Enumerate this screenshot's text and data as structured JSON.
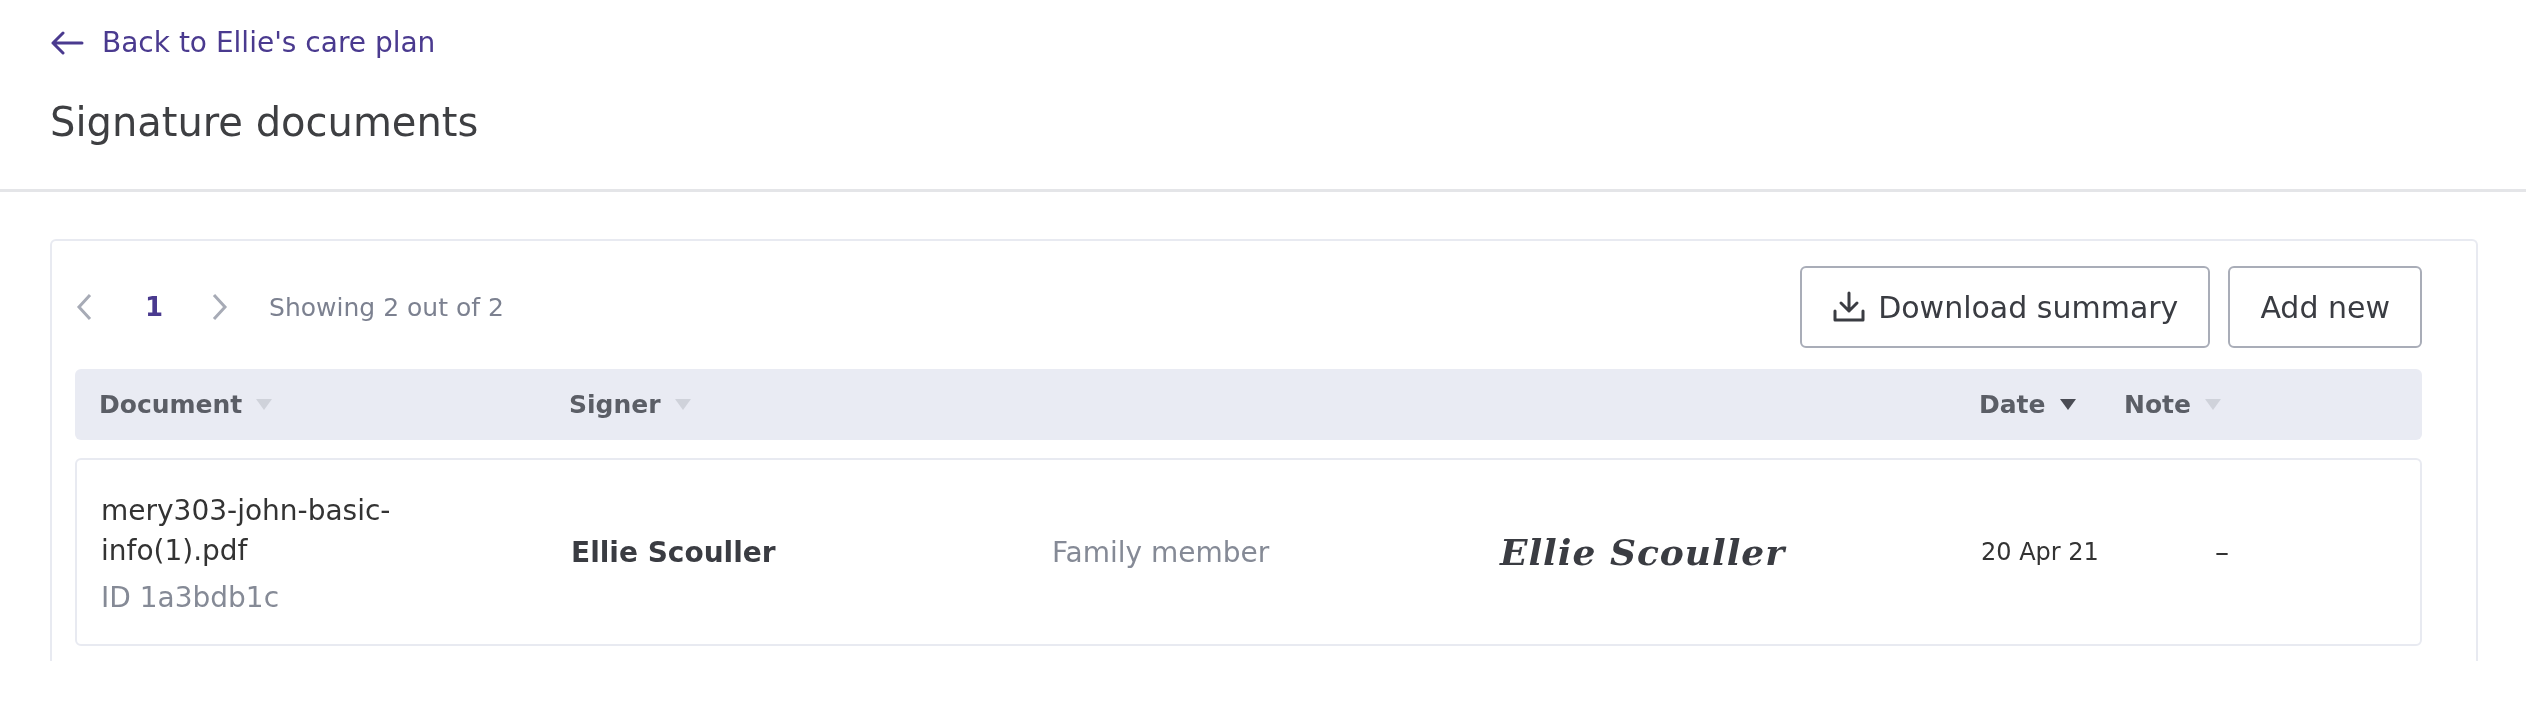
{
  "back_link": {
    "label": "Back to Ellie's care plan"
  },
  "title": "Signature documents",
  "pagination": {
    "pages": [
      {
        "label": "1",
        "selected": true
      }
    ],
    "summary": "Showing 2 out of 2"
  },
  "buttons": [
    {
      "label": "Download summary",
      "kind": "download"
    },
    {
      "label": "Add new",
      "kind": "plain"
    }
  ],
  "table": {
    "columns": [
      {
        "label": "Document",
        "sorted": false
      },
      {
        "label": "Signer",
        "sorted": false
      },
      {
        "label": "Date",
        "sorted": true
      },
      {
        "label": "Note",
        "sorted": false
      }
    ],
    "rows": [
      {
        "document": "mery303-john-basic-info(1).pdf",
        "id": "ID 1a3bdb1c",
        "signer": "Ellie Scouller",
        "role": "Family member",
        "signature": "Ellie Scouller",
        "date": "20 Apr 21",
        "note": "–"
      }
    ]
  }
}
